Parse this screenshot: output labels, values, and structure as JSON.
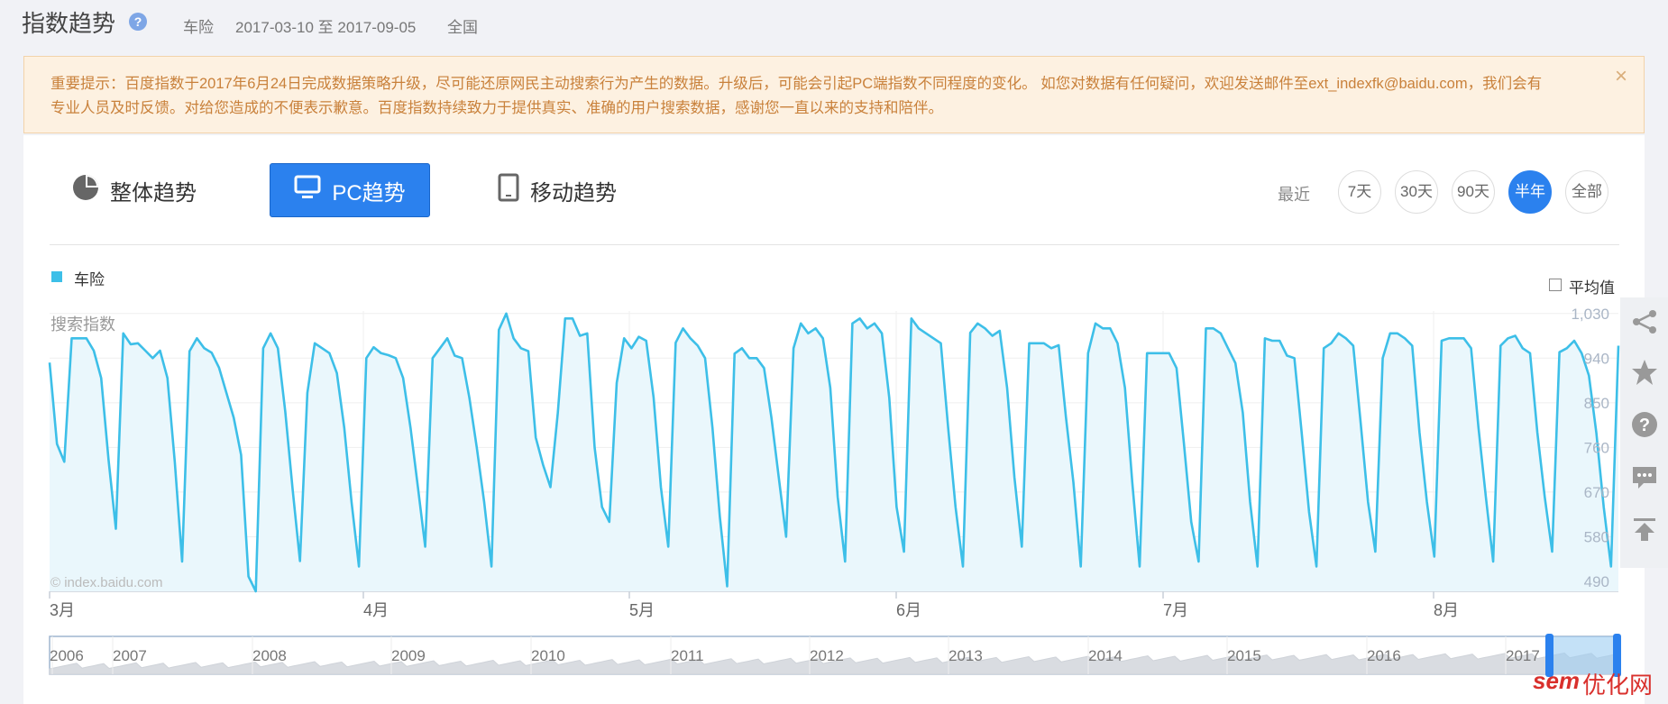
{
  "header": {
    "title": "指数趋势",
    "help_icon": "help-icon",
    "keyword": "车险",
    "date_range": "2017-03-10 至 2017-09-05",
    "region": "全国"
  },
  "notice": {
    "text": "重要提示：百度指数于2017年6月24日完成数据策略升级，尽可能还原网民主动搜索行为产生的数据。升级后，可能会引起PC端指数不同程度的变化。 如您对数据有任何疑问，欢迎发送邮件至ext_indexfk@baidu.com，我们会有专业人员及时反馈。对给您造成的不便表示歉意。百度指数持续致力于提供真实、准确的用户搜索数据，感谢您一直以来的支持和陪伴。",
    "close_label": "×"
  },
  "tabs": [
    {
      "label": "整体趋势",
      "icon": "pie-chart-icon",
      "active": false
    },
    {
      "label": "PC趋势",
      "icon": "monitor-icon",
      "active": true
    },
    {
      "label": "移动趋势",
      "icon": "tablet-icon",
      "active": false
    }
  ],
  "range": {
    "label": "最近",
    "options": [
      "7天",
      "30天",
      "90天",
      "半年",
      "全部"
    ],
    "selected": "半年"
  },
  "legend": {
    "series_name": "车险",
    "color": "#3dbfe8"
  },
  "average_toggle": "平均值",
  "colors": {
    "accent": "#2b81ee",
    "series": "#3dbfe8",
    "fill": "#eaf7fc"
  },
  "chart_data": {
    "type": "area",
    "ylabel": "搜索指数",
    "y_ticks": [
      "1,030",
      "940",
      "850",
      "760",
      "670",
      "580",
      "490"
    ],
    "ylim": [
      470,
      1035
    ],
    "x_tick_labels": [
      "3月",
      "4月",
      "5月",
      "6月",
      "7月",
      "8月"
    ],
    "watermark": "© index.baidu.com",
    "series": [
      {
        "name": "车险",
        "values": [
          931,
          767,
          731,
          980,
          980,
          980,
          955,
          900,
          735,
          596,
          990,
          968,
          970,
          955,
          940,
          955,
          900,
          730,
          530,
          954,
          980,
          960,
          951,
          921,
          870,
          820,
          745,
          500,
          470,
          960,
          990,
          960,
          832,
          675,
          531,
          870,
          970,
          960,
          950,
          910,
          800,
          650,
          520,
          940,
          962,
          950,
          946,
          940,
          900,
          800,
          680,
          560,
          940,
          960,
          980,
          945,
          940,
          860,
          760,
          650,
          520,
          997,
          1030,
          980,
          960,
          954,
          780,
          725,
          680,
          830,
          1020,
          1020,
          985,
          990,
          760,
          640,
          610,
          890,
          980,
          960,
          983,
          975,
          861,
          680,
          560,
          971,
          1000,
          980,
          965,
          940,
          800,
          620,
          480,
          949,
          960,
          940,
          940,
          920,
          820,
          700,
          580,
          960,
          1010,
          990,
          1000,
          980,
          880,
          660,
          530,
          1010,
          1020,
          1000,
          1010,
          990,
          860,
          640,
          550,
          1020,
          1000,
          990,
          980,
          970,
          800,
          640,
          520,
          991,
          1010,
          1000,
          985,
          995,
          880,
          700,
          560,
          970,
          970,
          970,
          960,
          966,
          820,
          690,
          520,
          950,
          1010,
          1000,
          1000,
          970,
          880,
          690,
          520,
          950,
          950,
          950,
          950,
          920,
          770,
          610,
          530,
          1000,
          1000,
          990,
          960,
          930,
          830,
          650,
          520,
          980,
          975,
          975,
          945,
          940,
          790,
          630,
          520,
          960,
          970,
          990,
          980,
          965,
          810,
          650,
          550,
          940,
          990,
          990,
          980,
          965,
          790,
          650,
          540,
          975,
          980,
          980,
          980,
          960,
          800,
          660,
          530,
          965,
          980,
          985,
          960,
          950,
          790,
          660,
          550,
          952,
          960,
          975,
          950,
          905,
          790,
          640,
          520,
          965
        ]
      }
    ]
  },
  "navigator": {
    "years": [
      "2006",
      "2007",
      "2008",
      "2009",
      "2010",
      "2011",
      "2012",
      "2013",
      "2014",
      "2015",
      "2016",
      "2017"
    ]
  },
  "side_tools": [
    "share-icon",
    "star-icon",
    "question-icon",
    "comment-icon",
    "back-to-top-icon"
  ],
  "watermark_brand": {
    "part1": "sem",
    "part2": "优化网"
  }
}
